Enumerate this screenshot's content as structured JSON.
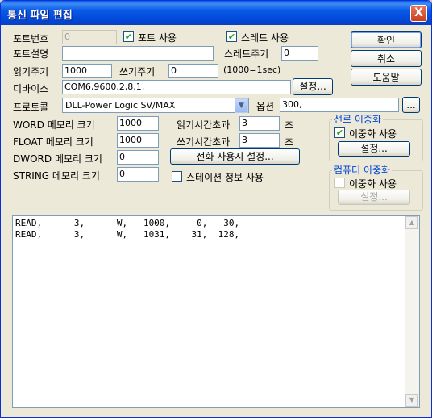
{
  "window": {
    "title": "통신 파일 편집",
    "close_glyph": "X"
  },
  "port": {
    "number_label": "포트번호",
    "number_value": "0",
    "use_label": "포트 사용",
    "use_checked": true,
    "thread_label": "스레드 사용",
    "thread_checked": true,
    "desc_label": "포트설명",
    "desc_value": "",
    "thread_period_label": "스레드주기",
    "thread_period_value": "0"
  },
  "cycles": {
    "read_label": "읽기주기",
    "read_value": "1000",
    "write_label": "쓰기주기",
    "write_value": "0",
    "unit_note": "(1000=1sec)"
  },
  "device": {
    "label": "디바이스",
    "value": "COM6,9600,2,8,1,",
    "settings_button": "설정..."
  },
  "protocol": {
    "label": "프로토콜",
    "value": "DLL-Power Logic SV/MAX",
    "option_label": "옵션",
    "option_value": "300,",
    "option_button": "..."
  },
  "memory": {
    "word_label": "WORD 메모리 크기",
    "word_value": "1000",
    "float_label": "FLOAT 메모리 크기",
    "float_value": "1000",
    "dword_label": "DWORD 메모리 크기",
    "dword_value": "0",
    "string_label": "STRING 메모리 크기",
    "string_value": "0"
  },
  "timeouts": {
    "read_label": "읽기시간초과",
    "read_value": "3",
    "read_unit": "초",
    "write_label": "쓰기시간초과",
    "write_value": "3",
    "write_unit": "초",
    "phone_button": "전화 사용시 설정...",
    "station_label": "스테이션 정보 사용",
    "station_checked": false
  },
  "buttons": {
    "ok": "확인",
    "cancel": "취소",
    "help": "도움말"
  },
  "line_redundancy": {
    "title": "선로 이중화",
    "use_label": "이중화 사용",
    "use_checked": true,
    "settings": "설정..."
  },
  "computer_redundancy": {
    "title": "컴퓨터 이중화",
    "use_label": "이중화 사용",
    "use_checked": false,
    "settings": "설정..."
  },
  "commands": [
    "READ,      3,      W,   1000,     0,   30,",
    "READ,      3,      W,   1031,    31,  128,"
  ],
  "colors": {
    "titlebar": "#0a5ae8",
    "dialog_bg": "#ece9d8",
    "group_title": "#0046d5",
    "check": "#21a121"
  }
}
